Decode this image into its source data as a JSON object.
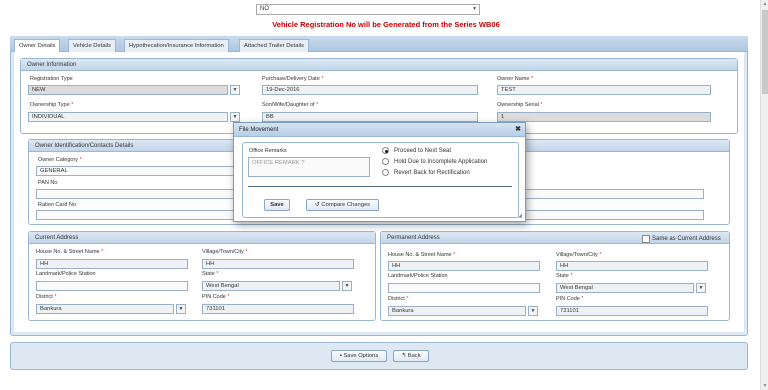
{
  "top_select": {
    "value": "NO"
  },
  "series_notice": "Vehicle Registration No will be Generated from the Series WB06",
  "tabs": [
    {
      "label": "Owner Details"
    },
    {
      "label": "Vehicle Details"
    },
    {
      "label": "Hypothecation/Insurance Information"
    },
    {
      "label": "Attached Trailer Details"
    }
  ],
  "owner_info": {
    "title": "Owner Information",
    "registration_type": {
      "label": "Registration Type",
      "value": "NEW"
    },
    "purchase_date": {
      "label": "Purchase/Delivery Date",
      "value": "19-Dec-2016"
    },
    "owner_name": {
      "label": "Owner Name",
      "value": "TEST"
    },
    "ownership_type": {
      "label": "Ownership Type",
      "value": "INDIVIDUAL"
    },
    "son_wife_daughter": {
      "label": "Son/Wife/Daughter of",
      "value": "BB"
    },
    "ownership_serial": {
      "label": "Ownership Serial",
      "value": "1"
    }
  },
  "owner_ident": {
    "title": "Owner Identification/Contacts Details",
    "owner_category": {
      "label": "Owner Category",
      "value": "GENERAL"
    },
    "pan_no": {
      "label": "PAN No",
      "value": ""
    },
    "ration_card_no": {
      "label": "Ration Card No",
      "value": ""
    }
  },
  "current_address": {
    "title": "Current Address",
    "house_label": "House No. & Street Name",
    "house_value": "HH",
    "village_label": "Village/Town/City",
    "village_value": "HH",
    "landmark_label": "Landmark/Police Station",
    "landmark_value": "",
    "state_label": "State",
    "state_value": "West Bengal",
    "district_label": "District",
    "district_value": "Bankura",
    "pin_label": "PIN Code",
    "pin_value": "731101"
  },
  "permanent_address": {
    "title": "Permanent Address",
    "same_label": "Same as Current Address",
    "house_label": "House No. & Street Name",
    "house_value": "HH",
    "village_label": "Village/Town/City",
    "village_value": "HH",
    "landmark_label": "Landmark/Police Station",
    "landmark_value": "",
    "state_label": "State",
    "state_value": "West Bengal",
    "district_label": "District",
    "district_value": "Bankura",
    "pin_label": "PIN Code",
    "pin_value": "731101"
  },
  "footer": {
    "save_options": "Save Options",
    "back": "Back"
  },
  "modal": {
    "title": "File Movement",
    "office_remarks_label": "Office Remarks",
    "office_remarks_placeholder": "OFFICE REMARK ?",
    "options": [
      {
        "label": "Proceed to Next Seat",
        "selected": true
      },
      {
        "label": "Hold Due to Incomplete Application",
        "selected": false
      },
      {
        "label": "Revert Back for Rectification",
        "selected": false
      }
    ],
    "save": "Save",
    "compare": "Compare Changes"
  },
  "colors": {
    "notice": "#cc0000",
    "accent": "#9ab7d4"
  }
}
